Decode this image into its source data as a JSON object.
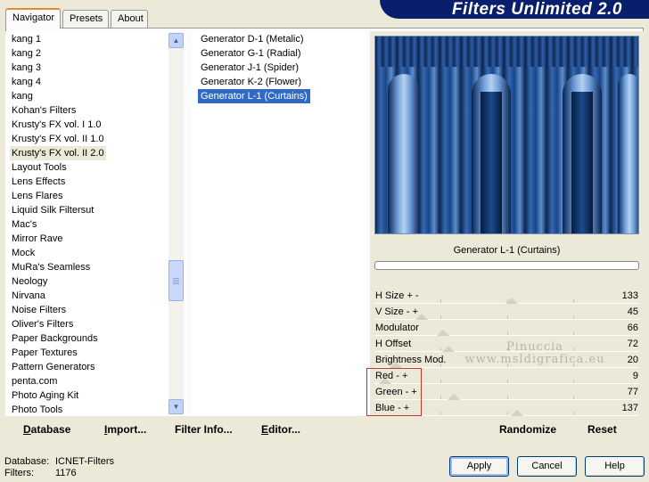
{
  "tabs": [
    {
      "label": "Navigator",
      "active": true
    },
    {
      "label": "Presets",
      "active": false
    },
    {
      "label": "About",
      "active": false
    }
  ],
  "banner": {
    "title": "Filters Unlimited 2.0"
  },
  "categories": {
    "items": [
      "kang 1",
      "kang 2",
      "kang 3",
      "kang 4",
      "kang",
      "Kohan's Filters",
      "Krusty's FX vol. I 1.0",
      "Krusty's FX vol. II 1.0",
      "Krusty's FX vol. II 2.0",
      "Layout Tools",
      "Lens Effects",
      "Lens Flares",
      "Liquid Silk Filtersut",
      "Mac's",
      "Mirror Rave",
      "Mock",
      "MuRa's Seamless",
      "Neology",
      "Nirvana",
      "Noise Filters",
      "Oliver's Filters",
      "Paper Backgrounds",
      "Paper Textures",
      "Pattern Generators",
      "penta.com",
      "Photo Aging Kit",
      "Photo Tools"
    ],
    "selected": "Krusty's FX vol. II 2.0"
  },
  "filters": {
    "items": [
      "Generator D-1 (Metalic)",
      "Generator G-1 (Radial)",
      "Generator J-1 (Spider)",
      "Generator K-2 (Flower)",
      "Generator L-1 (Curtains)"
    ],
    "selected": "Generator L-1 (Curtains)"
  },
  "preview": {
    "filter_name": "Generator L-1 (Curtains)",
    "progress": 0
  },
  "params": [
    {
      "label": "H Size + -",
      "value": "133",
      "level": 0.52
    },
    {
      "label": "V Size - +",
      "value": "45",
      "level": 0.18
    },
    {
      "label": "Modulator",
      "value": "66",
      "level": 0.26
    },
    {
      "label": "H Offset",
      "value": "72",
      "level": 0.28
    },
    {
      "label": "Brightness Mod.",
      "value": "20",
      "level": 0.08
    },
    {
      "label": "Red - +",
      "value": "9",
      "level": 0.04
    },
    {
      "label": "Green - +",
      "value": "77",
      "level": 0.3
    },
    {
      "label": "Blue - +",
      "value": "137",
      "level": 0.54
    }
  ],
  "watermark": {
    "line1": "Pinuccia",
    "line2": "www.msldigrafica.eu"
  },
  "toolbar": {
    "database": {
      "underline": "D",
      "rest": "atabase"
    },
    "import": {
      "underline": "I",
      "rest": "mport..."
    },
    "filter_info": {
      "underline": "",
      "rest": "Filter Info..."
    },
    "editor": {
      "underline": "E",
      "rest": "ditor..."
    },
    "randomize": "Randomize",
    "reset": "Reset"
  },
  "info": {
    "database_label": "Database:",
    "database_value": "ICNET-Filters",
    "filters_label": "Filters:",
    "filters_value": "1176"
  },
  "buttons": {
    "apply": "Apply",
    "cancel": "Cancel",
    "help": "Help"
  }
}
